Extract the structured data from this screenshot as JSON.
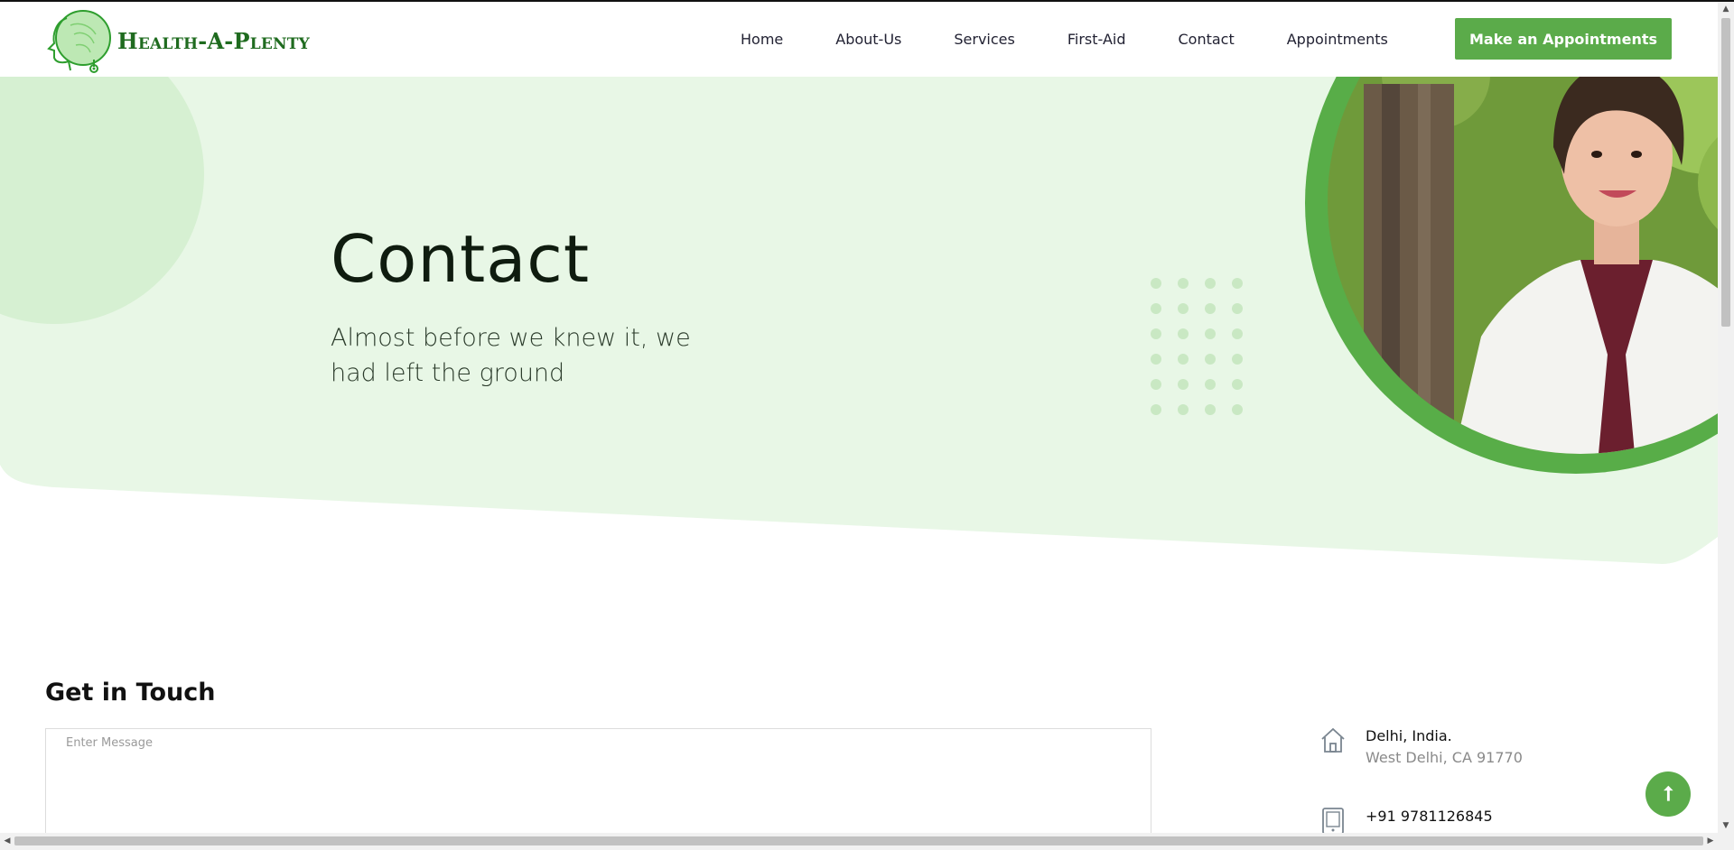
{
  "brand": {
    "name": "Health-A-Plenty"
  },
  "nav": {
    "items": [
      "Home",
      "About-Us",
      "Services",
      "First-Aid",
      "Contact",
      "Appointments"
    ],
    "cta_label": "Make an Appointments"
  },
  "hero": {
    "title": "Contact",
    "subtitle": "Almost before we knew it, we had left the ground"
  },
  "contact": {
    "section_title": "Get in Touch",
    "message_placeholder": "Enter Message",
    "address_line1": "Delhi, India.",
    "address_line2": "West Delhi, CA 91770",
    "phone": "+91 9781126845"
  },
  "colors": {
    "accent": "#5bab4a",
    "hero_bg": "#e8f7e6",
    "brand_text": "#1f6b1f"
  },
  "icons": {
    "home": "home-icon",
    "phone": "tablet-phone-icon",
    "scroll_top": "arrow-up-icon"
  }
}
